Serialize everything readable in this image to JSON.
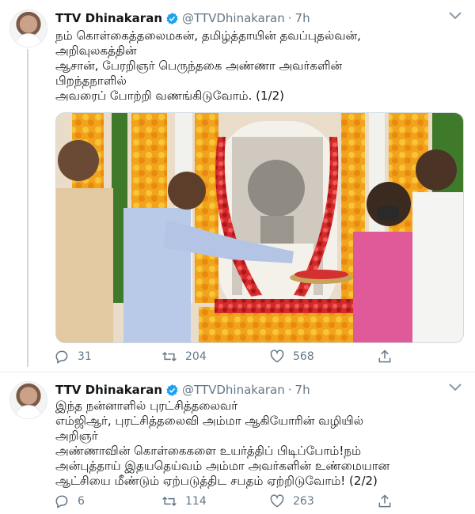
{
  "tweets": [
    {
      "author": "TTV Dhinakaran",
      "handle": "@TTVDhinakaran",
      "separator": "·",
      "time": "7h",
      "lines": [
        "நம் கொள்கைத்தலைமகன், தமிழ்த்தாயின் தவப்புதல்வன்,",
        "அறிவுலகத்தின்",
        "ஆசான், பேரறிஞர் பெருந்தகை அண்ணா அவர்களின்",
        "பிறந்தநாளில்",
        "அவரைப் போற்றி வணங்கிடுவோம். (1/2)"
      ],
      "replies": "31",
      "retweets": "204",
      "likes": "568"
    },
    {
      "author": "TTV Dhinakaran",
      "handle": "@TTVDhinakaran",
      "separator": "·",
      "time": "7h",
      "lines": [
        "இந்த நன்னாளில் புரட்சித்தலைவர்",
        "எம்ஜிஆர், புரட்சித்தலைவி அம்மா ஆகியோரின் வழியில்",
        "அறிஞர்",
        "அண்ணாவின் கொள்கைகளை உயர்த்திப் பிடிப்போம்!நம்",
        "அன்புத்தாய் இதயதெய்வம் அம்மா அவர்களின் உண்மையான",
        "ஆட்சியை மீண்டும் ஏற்படுத்திட சபதம் ஏற்றிடுவோம்! (2/2)"
      ],
      "replies": "6",
      "retweets": "114",
      "likes": "263"
    }
  ],
  "colors": {
    "verified": "#1da1f2",
    "secondary_text": "#657786",
    "primary_text": "#14171a"
  },
  "icons": [
    "verified-badge-icon",
    "chevron-down-icon",
    "reply-icon",
    "retweet-icon",
    "like-icon",
    "share-icon"
  ]
}
